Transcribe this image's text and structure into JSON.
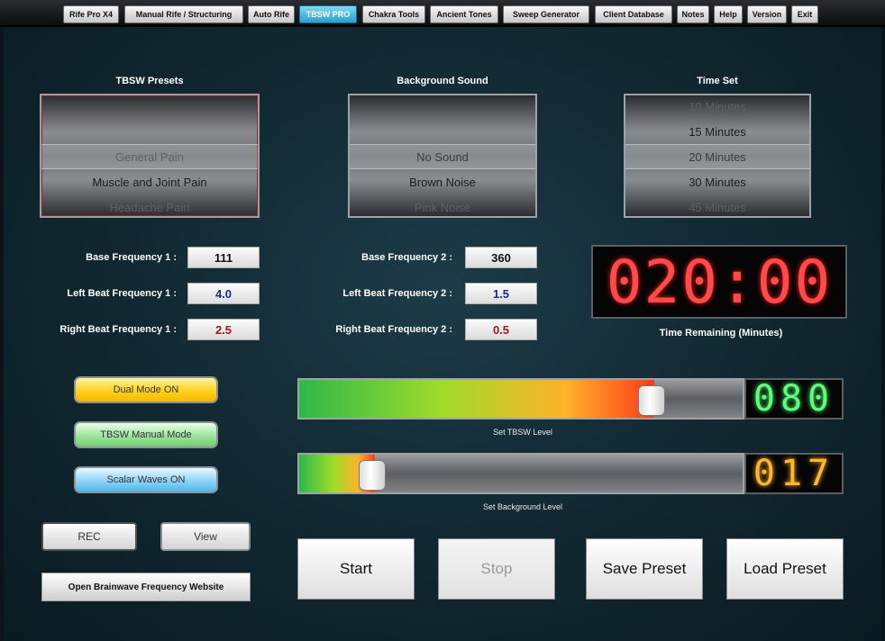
{
  "tabs": [
    {
      "label": "Rife Pro X4",
      "active": false
    },
    {
      "label": "Manual Rife / Structuring",
      "active": false
    },
    {
      "label": "Auto Rife",
      "active": false
    },
    {
      "label": "TBSW PRO",
      "active": true
    },
    {
      "label": "Chakra Tools",
      "active": false
    },
    {
      "label": "Ancient Tones",
      "active": false
    },
    {
      "label": "Sweep Generator",
      "active": false
    },
    {
      "label": "Client Database",
      "active": false
    },
    {
      "label": "Notes",
      "active": false
    },
    {
      "label": "Help",
      "active": false
    },
    {
      "label": "Version",
      "active": false
    },
    {
      "label": "Exit",
      "active": false
    }
  ],
  "presets": {
    "title": "TBSW Presets",
    "items": [
      "General Pain",
      "Muscle and Joint Pain",
      "Headache Pain"
    ],
    "selected": "General Pain"
  },
  "background_sound": {
    "title": "Background Sound",
    "items": [
      "No Sound",
      "Brown Noise",
      "Pink Noise"
    ],
    "selected": "No Sound"
  },
  "time_set": {
    "title": "Time Set",
    "items": [
      "10 Minutes",
      "15 Minutes",
      "20 Minutes",
      "30 Minutes",
      "45 Minutes"
    ],
    "selected": "20 Minutes"
  },
  "freq1": {
    "base_label": "Base Frequency 1 :",
    "base_value": "111",
    "left_label": "Left Beat Frequency 1 :",
    "left_value": "4.0",
    "right_label": "Right Beat Frequency 1 :",
    "right_value": "2.5"
  },
  "freq2": {
    "base_label": "Base Frequency 2 :",
    "base_value": "360",
    "left_label": "Left Beat Frequency 2 :",
    "left_value": "1.5",
    "right_label": "Right Beat Frequency 2 :",
    "right_value": "0.5"
  },
  "timer": {
    "display": "020:00",
    "label": "Time Remaining (Minutes)"
  },
  "modes": {
    "dual": "Dual Mode ON",
    "manual": "TBSW Manual Mode",
    "scalar": "Scalar Waves ON"
  },
  "rec": {
    "rec_label": "REC",
    "view_label": "View"
  },
  "website_button": "Open Brainwave Frequency Website",
  "tbsw_level": {
    "label": "Set TBSW Level",
    "value": 80,
    "display": "080"
  },
  "background_level": {
    "label": "Set Background Level",
    "value": 17,
    "display": "017"
  },
  "actions": {
    "start": "Start",
    "stop": "Stop",
    "save": "Save Preset",
    "load": "Load Preset"
  },
  "colors": {
    "value_blue": "#1a2a8c",
    "value_red": "#a01818",
    "value_black": "#111111",
    "tbsw_readout": "#5dff7a",
    "bg_readout": "#ffb52e"
  }
}
